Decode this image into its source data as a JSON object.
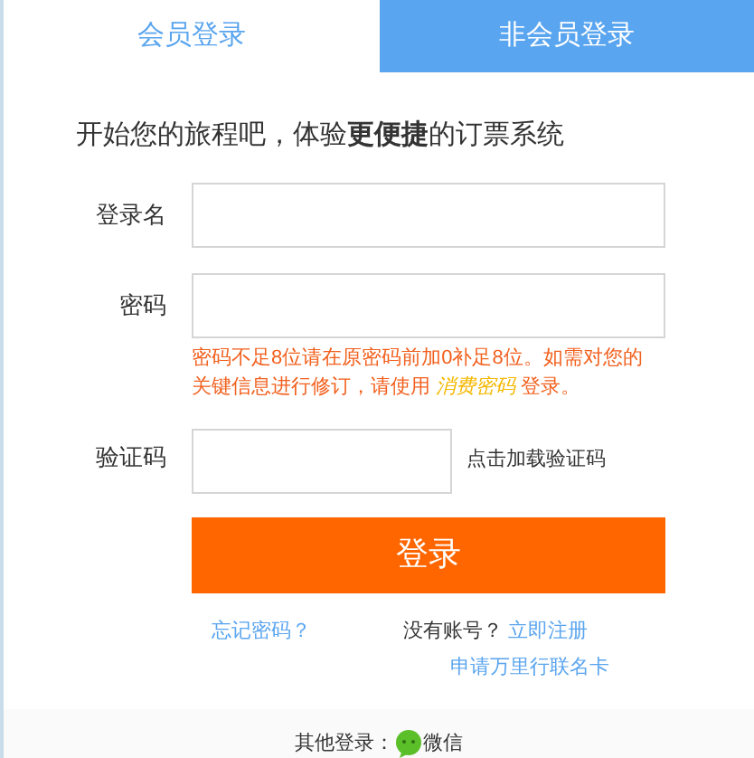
{
  "tabs": [
    {
      "label": "会员登录",
      "selected": true
    },
    {
      "label": "非会员登录",
      "selected": false
    }
  ],
  "intro": "开始您的旅程吧，体验**更便捷**的订票系统",
  "fields": [
    {
      "label": "登录名"
    },
    {
      "label": "密码"
    }
  ],
  "password_hint": {
    "before": "密码不足8位请在原密码前加0补足8位。如需对您的关键信息进行修订，请使用 ",
    "link": "消费密码",
    "after": " 登录。"
  },
  "captcha": {
    "label": "验证码",
    "link": "点击加载验证码"
  },
  "login_button": "登录",
  "forgot_password": "忘记密码？",
  "no_account": "没有账号？",
  "register": "立即注册",
  "apply_card": "申请万里行联名卡",
  "other_login": {
    "label": "其他登录：",
    "wechat": "微信"
  }
}
